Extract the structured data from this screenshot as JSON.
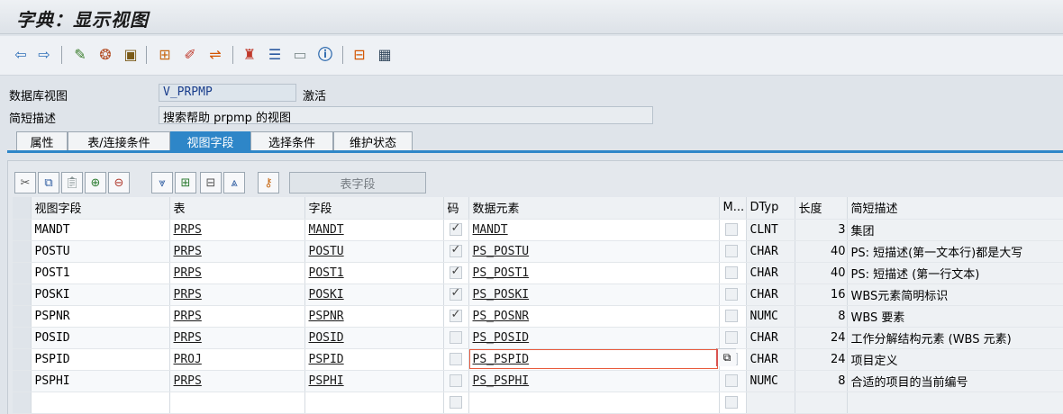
{
  "window": {
    "title": "字典：显示视图"
  },
  "toolbar": {
    "icons": [
      "back-icon",
      "forward-icon",
      "other-object-icon",
      "display-change-icon",
      "activate-icon",
      "where-used-icon",
      "wizard-icon",
      "navigate-icon",
      "hierarchy-icon",
      "align-icon",
      "list-icon",
      "info-icon",
      "tree-icon",
      "grid-icon"
    ]
  },
  "header": {
    "view_label": "数据库视图",
    "view_name": "V_PRPMP",
    "status": "激活",
    "desc_label": "简短描述",
    "desc_value": "搜索帮助 prpmp 的视图"
  },
  "tabs": [
    {
      "label": "属性"
    },
    {
      "label": "表/连接条件"
    },
    {
      "label": "视图字段",
      "active": true
    },
    {
      "label": "选择条件"
    },
    {
      "label": "维护状态"
    }
  ],
  "grid_toolbar": {
    "table_fields_label": "表字段"
  },
  "table": {
    "columns": [
      "视图字段",
      "表",
      "字段",
      "码",
      "数据元素",
      "M...",
      "DTyp",
      "长度",
      "简短描述"
    ],
    "rows": [
      {
        "view_field": "MANDT",
        "table": "PRPS",
        "field": "MANDT",
        "key": true,
        "element": "MANDT",
        "type": "CLNT",
        "length": "3",
        "desc": "集团"
      },
      {
        "view_field": "POSTU",
        "table": "PRPS",
        "field": "POSTU",
        "key": true,
        "element": "PS_POSTU",
        "type": "CHAR",
        "length": "40",
        "desc": "PS: 短描述(第一文本行)都是大写"
      },
      {
        "view_field": "POST1",
        "table": "PRPS",
        "field": "POST1",
        "key": true,
        "element": "PS_POST1",
        "type": "CHAR",
        "length": "40",
        "desc": "PS: 短描述 (第一行文本)"
      },
      {
        "view_field": "POSKI",
        "table": "PRPS",
        "field": "POSKI",
        "key": true,
        "element": "PS_POSKI",
        "type": "CHAR",
        "length": "16",
        "desc": "WBS元素简明标识"
      },
      {
        "view_field": "PSPNR",
        "table": "PRPS",
        "field": "PSPNR",
        "key": true,
        "element": "PS_POSNR",
        "type": "NUMC",
        "length": "8",
        "desc": "WBS 要素"
      },
      {
        "view_field": "POSID",
        "table": "PRPS",
        "field": "POSID",
        "key": false,
        "element": "PS_POSID",
        "type": "CHAR",
        "length": "24",
        "desc": "工作分解结构元素 (WBS 元素)"
      },
      {
        "view_field": "PSPID",
        "table": "PROJ",
        "field": "PSPID",
        "key": false,
        "element": "PS_PSPID",
        "type": "CHAR",
        "length": "24",
        "desc": "项目定义"
      },
      {
        "view_field": "PSPHI",
        "table": "PRPS",
        "field": "PSPHI",
        "key": false,
        "element": "PS_PSPHI",
        "type": "NUMC",
        "length": "8",
        "desc": "合适的项目的当前编号"
      }
    ]
  }
}
